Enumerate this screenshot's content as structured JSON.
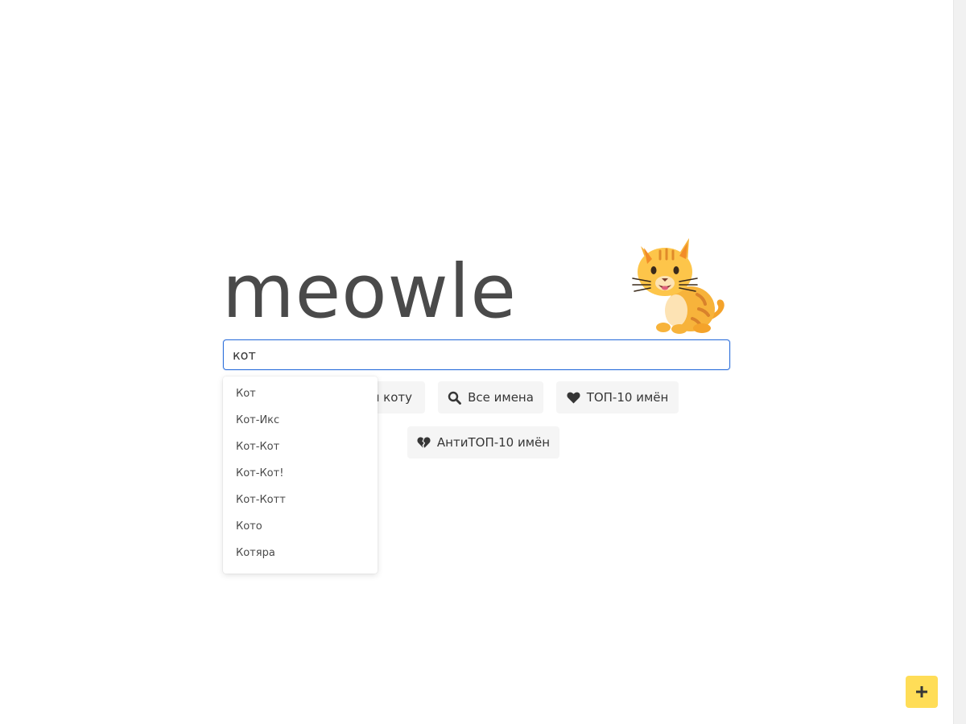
{
  "logo": {
    "text": "meowle"
  },
  "search": {
    "value": "кот",
    "placeholder": ""
  },
  "suggestions": [
    "Кот",
    "Кот-Икс",
    "Кот-Кот",
    "Кот-Кот!",
    "Кот-Котт",
    "Кото",
    "Котяра"
  ],
  "buttons": {
    "find_label": "я коту",
    "all_names_label": "Все имена",
    "top10_label": "ТОП-10 имён",
    "antitop10_label": "АнтиТОП-10 имён"
  },
  "icons": {
    "cat": "cat-emoji-icon",
    "search": "search-icon",
    "heart": "heart-icon",
    "broken_heart": "broken-heart-icon",
    "plus": "plus-icon"
  },
  "colors": {
    "accent": "#3273dc",
    "fab": "#ffdd57",
    "button_bg": "#f5f5f5",
    "text": "#4a4a4a"
  }
}
